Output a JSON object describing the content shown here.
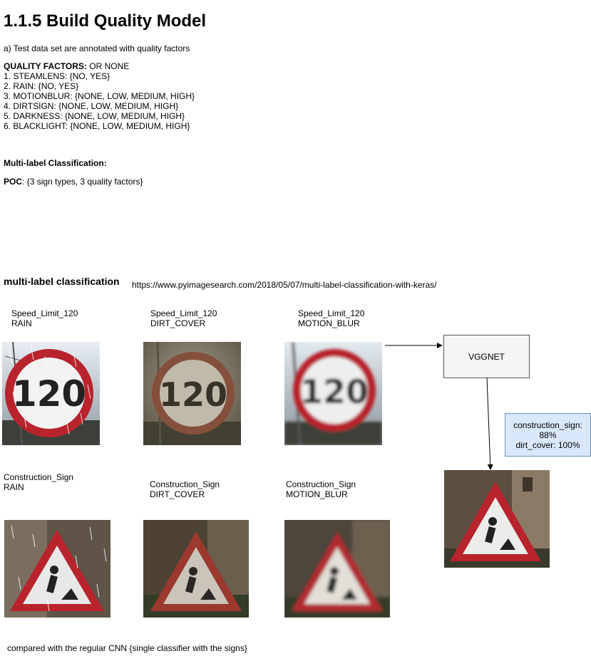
{
  "title": "1.1.5 Build Quality Model",
  "intro": "a) Test data set are annotated with quality factors",
  "quality_factors": {
    "heading": "QUALITY FACTORS:",
    "heading_suffix": " OR NONE",
    "items": [
      "1. STEAMLENS: {NO, YES}",
      "2. RAIN: {NO, YES}",
      "3. MOTIONBLUR: {NONE, LOW, MEDIUM, HIGH}",
      "4. DIRTSIGN: {NONE, LOW, MEDIUM, HIGH}",
      "5. DARKNESS: {NONE, LOW, MEDIUM, HIGH}",
      "6. BLACKLIGHT: {NONE, LOW, MEDIUM, HIGH}"
    ]
  },
  "multilabel_heading": "Multi-label Classification:",
  "poc": {
    "label": "POC",
    "text": ": {3 sign types, 3 quality factors}"
  },
  "section2_heading": "multi-label classification",
  "reference_url": "https://www.pyimagesearch.com/2018/05/07/multi-label-classification-with-keras/",
  "speed_images": [
    {
      "line1": "Speed_Limit_120",
      "line2": "RAIN",
      "number": "120"
    },
    {
      "line1": "Speed_Limit_120",
      "line2": "DIRT_COVER",
      "number": "120"
    },
    {
      "line1": "Speed_Limit_120",
      "line2": "MOTION_BLUR",
      "number": "120"
    }
  ],
  "construction_images": [
    {
      "line1": "Construction_Sign",
      "line2": "RAIN"
    },
    {
      "line1": "Construction_Sign",
      "line2": "DIRT_COVER"
    },
    {
      "line1": "Construction_Sign",
      "line2": "MOTION_BLUR"
    }
  ],
  "model_box": "VGGNET",
  "prediction": {
    "line1": "construction_sign:",
    "line2": "88%",
    "line3": "dirt_cover: 100%"
  },
  "footer": "compared with the regular CNN {single classifier with the signs}",
  "colors": {
    "note_fill": "#dae8fc",
    "note_border": "#6c8ebf",
    "sign_red": "#b8232c"
  }
}
